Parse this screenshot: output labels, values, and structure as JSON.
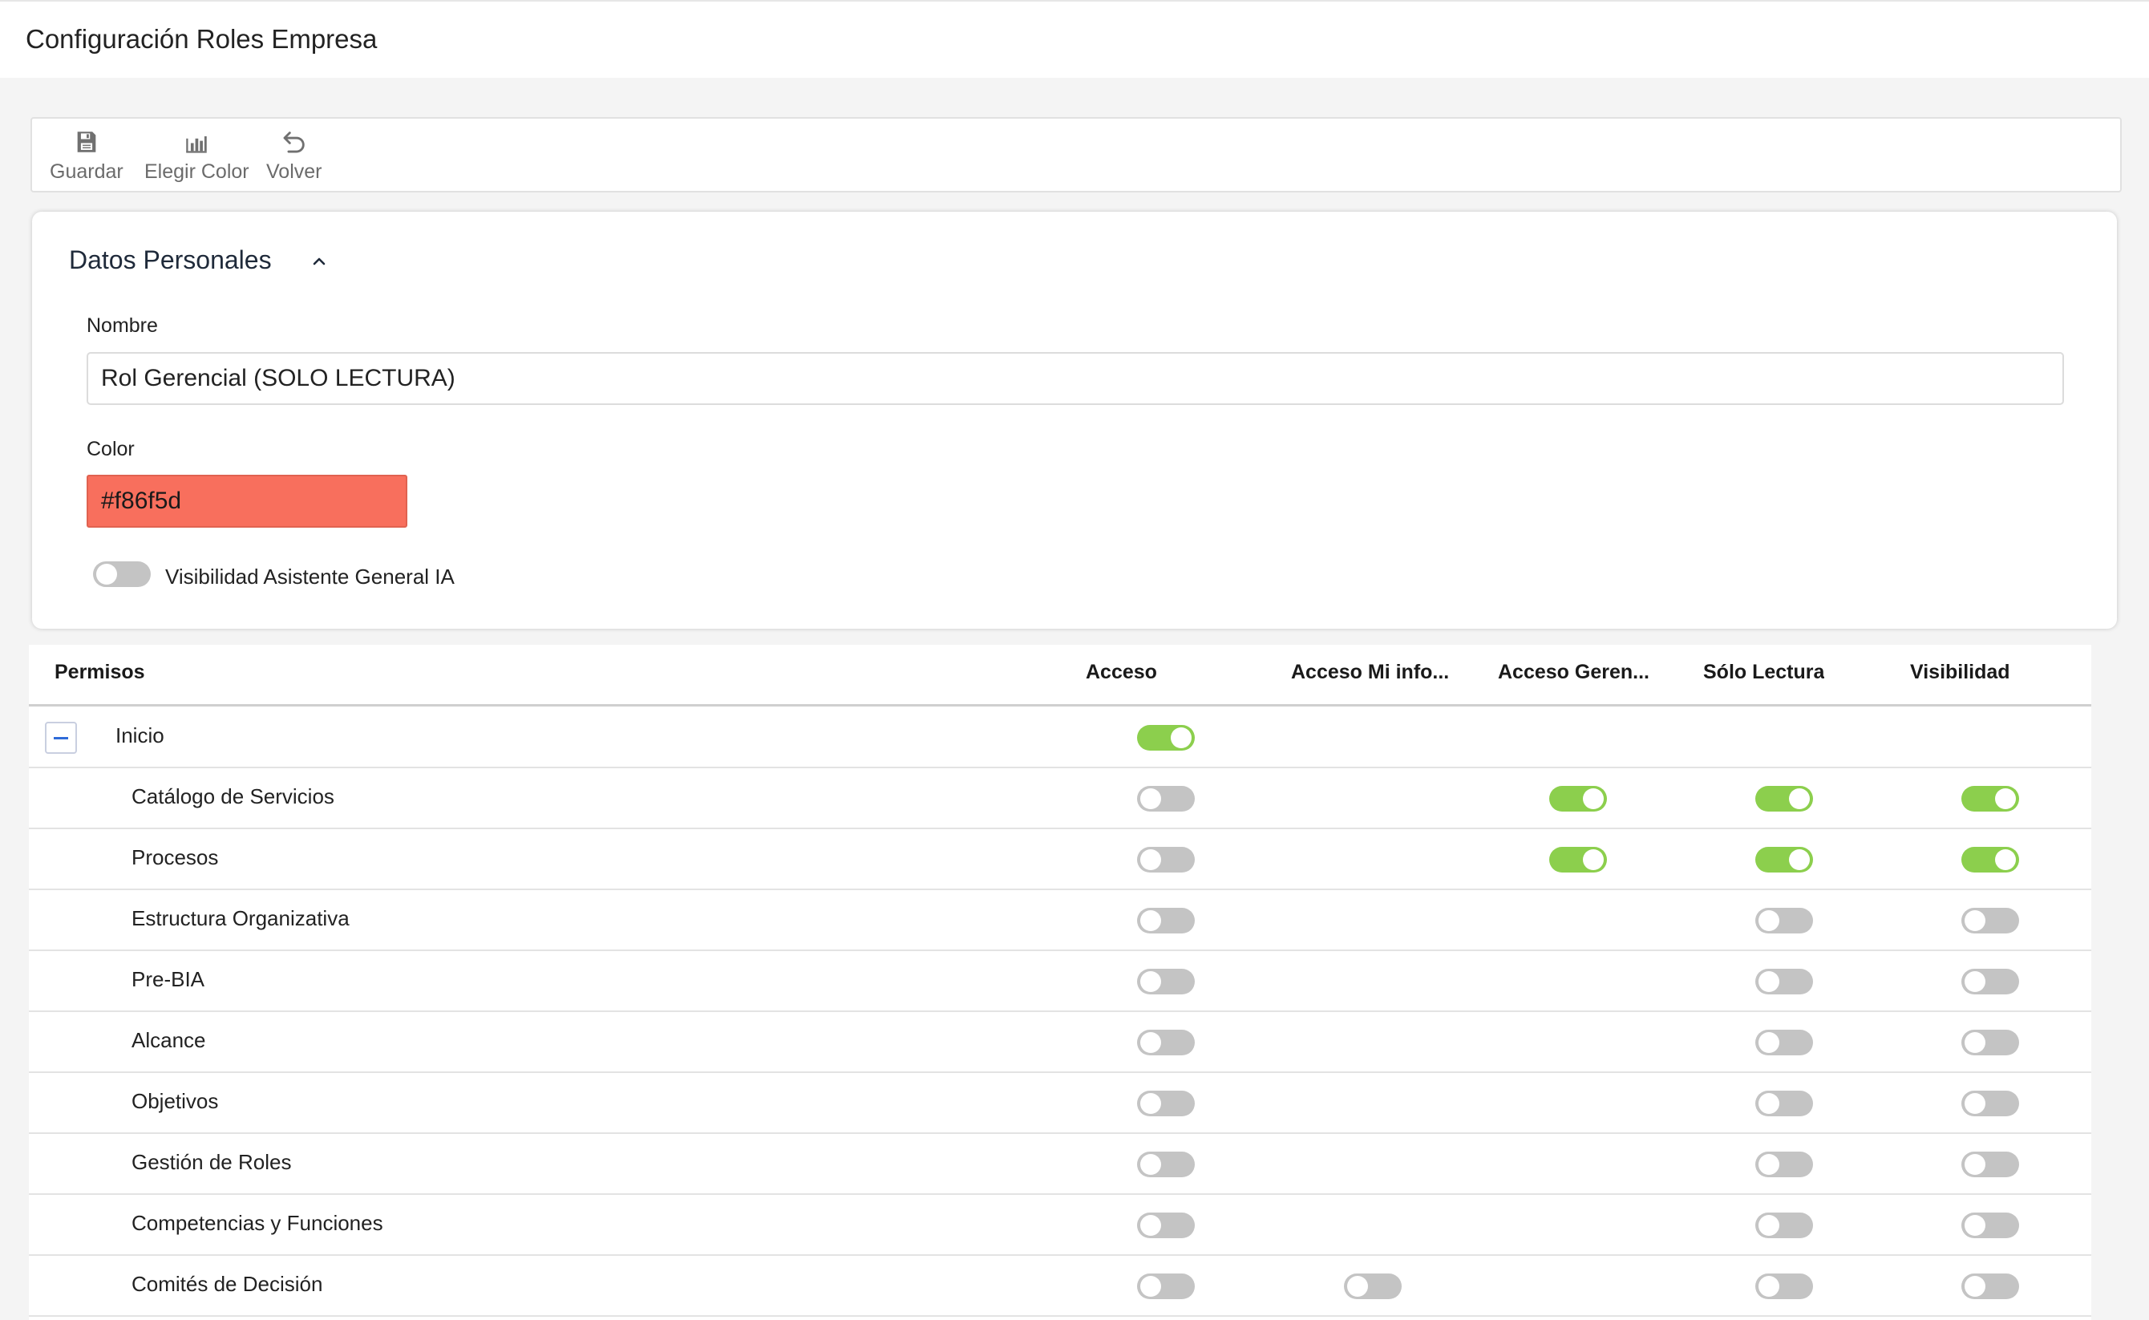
{
  "page": {
    "title": "Configuración Roles Empresa"
  },
  "toolbar": {
    "save_label": "Guardar",
    "color_label": "Elegir Color",
    "back_label": "Volver"
  },
  "personal": {
    "title": "Datos Personales",
    "name_label": "Nombre",
    "name_value": "Rol Gerencial (SOLO LECTURA)",
    "color_label": "Color",
    "color_value": "#f86f5d",
    "ia_label": "Visibilidad Asistente General IA",
    "ia_enabled": false
  },
  "permissions": {
    "columns": [
      "Permisos",
      "Acceso",
      "Acceso Mi info...",
      "Acceso Geren...",
      "Sólo Lectura",
      "Visibilidad"
    ],
    "rows": [
      {
        "label": "Inicio",
        "parent": true,
        "acceso": true,
        "mi_info": null,
        "gerencial": null,
        "solo_lectura": null,
        "visibilidad": null
      },
      {
        "label": "Catálogo de Servicios",
        "acceso": false,
        "mi_info": null,
        "gerencial": true,
        "solo_lectura": true,
        "visibilidad": true
      },
      {
        "label": "Procesos",
        "acceso": false,
        "mi_info": null,
        "gerencial": true,
        "solo_lectura": true,
        "visibilidad": true
      },
      {
        "label": "Estructura Organizativa",
        "acceso": false,
        "mi_info": null,
        "gerencial": null,
        "solo_lectura": false,
        "visibilidad": false
      },
      {
        "label": "Pre-BIA",
        "acceso": false,
        "mi_info": null,
        "gerencial": null,
        "solo_lectura": false,
        "visibilidad": false
      },
      {
        "label": "Alcance",
        "acceso": false,
        "mi_info": null,
        "gerencial": null,
        "solo_lectura": false,
        "visibilidad": false
      },
      {
        "label": "Objetivos",
        "acceso": false,
        "mi_info": null,
        "gerencial": null,
        "solo_lectura": false,
        "visibilidad": false
      },
      {
        "label": "Gestión de Roles",
        "acceso": false,
        "mi_info": null,
        "gerencial": null,
        "solo_lectura": false,
        "visibilidad": false
      },
      {
        "label": "Competencias y Funciones",
        "acceso": false,
        "mi_info": null,
        "gerencial": null,
        "solo_lectura": false,
        "visibilidad": false
      },
      {
        "label": "Comités de Decisión",
        "acceso": false,
        "mi_info": false,
        "gerencial": null,
        "solo_lectura": false,
        "visibilidad": false
      }
    ]
  },
  "colors": {
    "accent_on": "#8ccf4d",
    "off": "#c4c4c4",
    "role_color": "#f86f5d",
    "collapse": "#2f6bd8"
  }
}
